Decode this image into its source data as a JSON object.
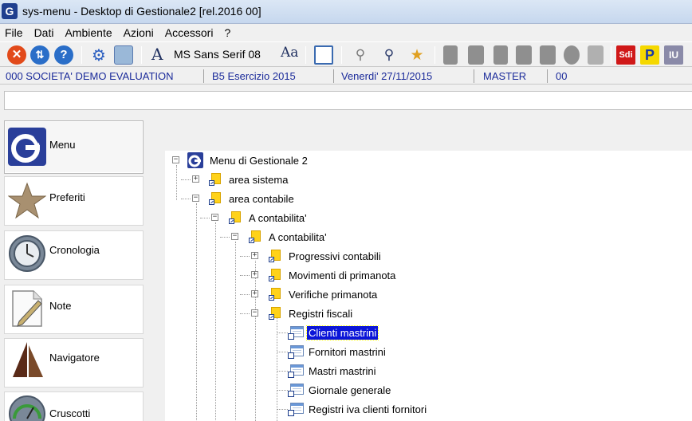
{
  "window": {
    "title": "sys-menu - Desktop di Gestionale2  [rel.2016 00]",
    "app_icon_letter": "G"
  },
  "menubar": {
    "items": [
      "File",
      "Dati",
      "Ambiente",
      "Azioni",
      "Accessori",
      "?"
    ]
  },
  "toolbar": {
    "font_name": "MS Sans Serif 08",
    "buttons": [
      "close-icon",
      "sync-icon",
      "help-icon",
      "settings-icon",
      "calculator-icon",
      "font-icon",
      "font-size-icon",
      "window-icon",
      "binoculars-icon",
      "binoculars-icon",
      "star-add-icon",
      "sdi-icon",
      "p-icon",
      "iu-icon"
    ],
    "badges": {
      "sdi": "Sdi",
      "p": "P",
      "iu": "IU"
    }
  },
  "status": {
    "company": "000 SOCIETA' DEMO EVALUATION",
    "exercise": "B5 Esercizio 2015",
    "date": "Venerdi' 27/11/2015",
    "user": "MASTER",
    "code": "00"
  },
  "command_line": {
    "value": ""
  },
  "nav": {
    "items": [
      {
        "label": "Menu",
        "icon": "gestionale-logo-icon",
        "active": true
      },
      {
        "label": "Preferiti",
        "icon": "star-icon",
        "active": false
      },
      {
        "label": "Cronologia",
        "icon": "clock-icon",
        "active": false
      },
      {
        "label": "Note",
        "icon": "note-pencil-icon",
        "active": false
      },
      {
        "label": "Navigatore",
        "icon": "sail-icon",
        "active": false
      },
      {
        "label": "Cruscotti",
        "icon": "gauge-icon",
        "active": false
      }
    ]
  },
  "tree": {
    "root": "Menu di Gestionale 2",
    "items": [
      {
        "label": "area sistema",
        "expanded": false
      },
      {
        "label": "area contabile",
        "expanded": true
      },
      {
        "label": "A contabilita'",
        "expanded": true
      },
      {
        "label": "A contabilita'",
        "expanded": true
      },
      {
        "label": "Progressivi contabili",
        "expanded": false
      },
      {
        "label": "Movimenti di primanota",
        "expanded": false
      },
      {
        "label": "Verifiche primanota",
        "expanded": false
      },
      {
        "label": "Registri fiscali",
        "expanded": true
      },
      {
        "label": "Clienti mastrini",
        "selected": true
      },
      {
        "label": "Fornitori mastrini"
      },
      {
        "label": "Mastri mastrini"
      },
      {
        "label": "Giornale generale"
      },
      {
        "label": "Registri iva clienti fornitori"
      }
    ]
  },
  "colors": {
    "selection": "#0b15d8",
    "status_text": "#1a2a9a",
    "folder": "#ffd21a"
  }
}
